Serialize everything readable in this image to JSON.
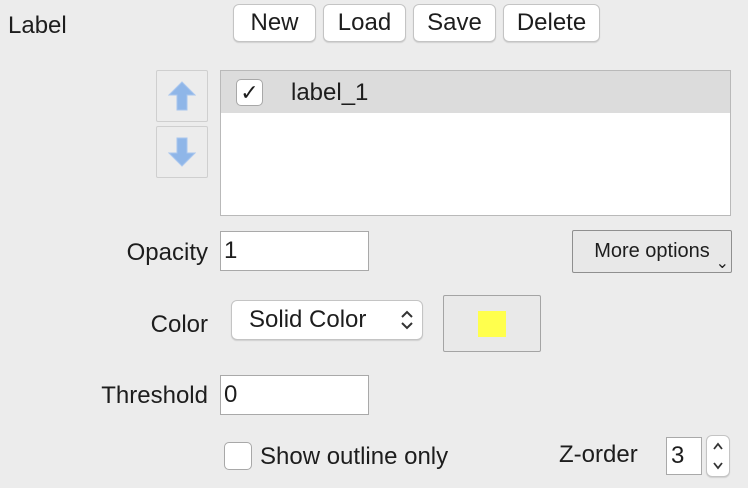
{
  "section": {
    "title": "Label"
  },
  "toolbar": {
    "new_label": "New",
    "load_label": "Load",
    "save_label": "Save",
    "delete_label": "Delete"
  },
  "reorder": {
    "up_icon": "arrow-up-icon",
    "down_icon": "arrow-down-icon"
  },
  "labels": {
    "items": [
      {
        "name": "label_1",
        "checked": true,
        "check_glyph": "✓"
      }
    ]
  },
  "opacity": {
    "label": "Opacity",
    "value": "1"
  },
  "more_options": {
    "label": "More options",
    "chevron": "⌄"
  },
  "color": {
    "label": "Color",
    "mode": "Solid Color",
    "swatch_hex": "#ffff4d"
  },
  "threshold": {
    "label": "Threshold",
    "value": "0"
  },
  "outline": {
    "label": "Show outline only",
    "checked": false
  },
  "zorder": {
    "label": "Z-order",
    "value": "3"
  },
  "colors": {
    "background": "#ececec",
    "selection_row": "#dcdcdc",
    "arrow_fill": "#8fb6e8"
  }
}
